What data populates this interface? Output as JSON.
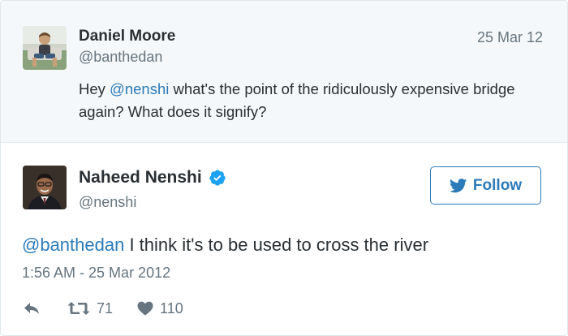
{
  "parent_tweet": {
    "name": "Daniel Moore",
    "handle": "@banthedan",
    "date": "25 Mar 12",
    "text_prefix": "Hey ",
    "mention": "@nenshi",
    "text_suffix": " what's the point of the ridiculously expensive bridge again? What does it signify?"
  },
  "main_tweet": {
    "name": "Naheed Nenshi",
    "verified": true,
    "handle": "@nenshi",
    "follow_label": "Follow",
    "mention": "@banthedan",
    "text_suffix": " I think it's to be used to cross the river",
    "timestamp": "1:56 AM - 25 Mar 2012",
    "retweets": "71",
    "likes": "110"
  },
  "colors": {
    "link": "#2b7bb9",
    "muted": "#66757f",
    "text": "#292f33",
    "parent_background": "#f5f8fa"
  },
  "icons": [
    "reply-icon",
    "retweet-icon",
    "heart-icon",
    "verified-badge-icon",
    "twitter-bird-icon"
  ]
}
